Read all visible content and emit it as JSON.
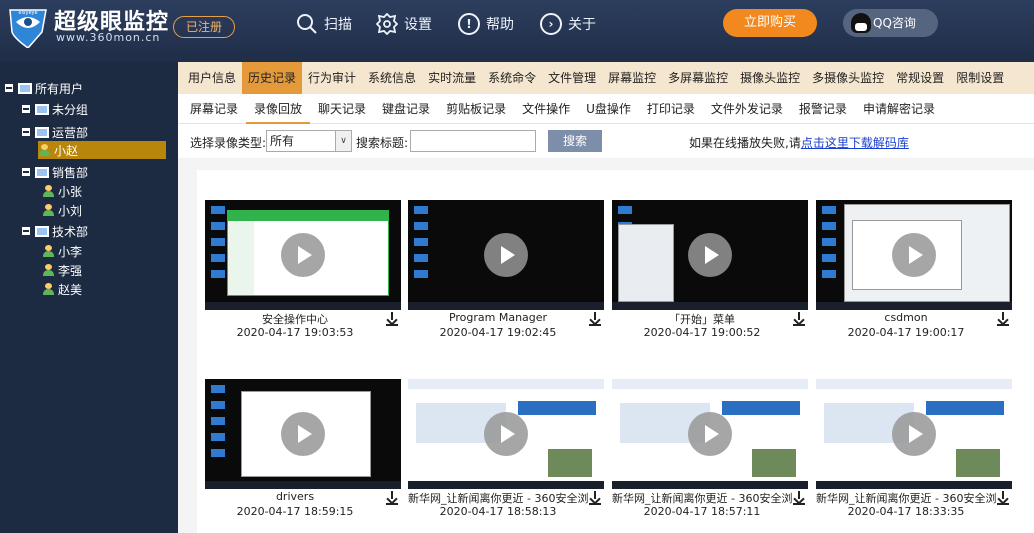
{
  "header": {
    "title": "超级眼监控",
    "url": "www.360mon.cn",
    "logo_mark_text": "eisyeye",
    "registered": "已注册",
    "nav": [
      {
        "icon": "search-icon",
        "label": "扫描"
      },
      {
        "icon": "gear-icon",
        "label": "设置"
      },
      {
        "icon": "help-icon",
        "label": "帮助"
      },
      {
        "icon": "chevron-right-icon",
        "label": "关于"
      }
    ],
    "buy": "立即购买",
    "qq": "QQ咨询"
  },
  "sidebar": {
    "root": "所有用户",
    "groups": [
      {
        "name": "未分组",
        "users": []
      },
      {
        "name": "运营部",
        "users": [
          "小赵"
        ]
      },
      {
        "name": "销售部",
        "users": [
          "小张",
          "小刘"
        ]
      },
      {
        "name": "技术部",
        "users": [
          "小李",
          "李强",
          "赵美"
        ]
      }
    ],
    "selected_user": "小赵"
  },
  "tabs_main": [
    "用户信息",
    "历史记录",
    "行为审计",
    "系统信息",
    "实时流量",
    "系统命令",
    "文件管理",
    "屏幕监控",
    "多屏幕监控",
    "摄像头监控",
    "多摄像头监控",
    "常规设置",
    "限制设置"
  ],
  "tabs_main_active": 1,
  "tabs_sub": [
    "屏幕记录",
    "录像回放",
    "聊天记录",
    "键盘记录",
    "剪贴板记录",
    "文件操作",
    "U盘操作",
    "打印记录",
    "文件外发记录",
    "报警记录",
    "申请解密记录"
  ],
  "tabs_sub_active": 1,
  "filter": {
    "type_label": "选择录像类型:",
    "type_value": "所有",
    "title_label": "搜索标题:",
    "title_value": "",
    "search_button": "搜索",
    "hint_text": "如果在线播放失败,请",
    "hint_link": "点击这里下载解码库"
  },
  "videos": [
    {
      "title": "安全操作中心",
      "time": "2020-04-17 19:03:53",
      "theme": "green"
    },
    {
      "title": "Program Manager",
      "time": "2020-04-17 19:02:45",
      "theme": "desktop"
    },
    {
      "title": "「开始」菜单",
      "time": "2020-04-17 19:00:52",
      "theme": "start"
    },
    {
      "title": "csdmon",
      "time": "2020-04-17 19:00:17",
      "theme": "explorer"
    },
    {
      "title": "drivers",
      "time": "2020-04-17 18:59:15",
      "theme": "explorer2"
    },
    {
      "title": "新华网_让新闻离你更近 - 360安全浏",
      "time": "2020-04-17 18:58:13",
      "theme": "web"
    },
    {
      "title": "新华网_让新闻离你更近 - 360安全浏",
      "time": "2020-04-17 18:57:11",
      "theme": "web"
    },
    {
      "title": "新华网_让新闻离你更近 - 360安全浏",
      "time": "2020-04-17 18:33:35",
      "theme": "web"
    }
  ]
}
